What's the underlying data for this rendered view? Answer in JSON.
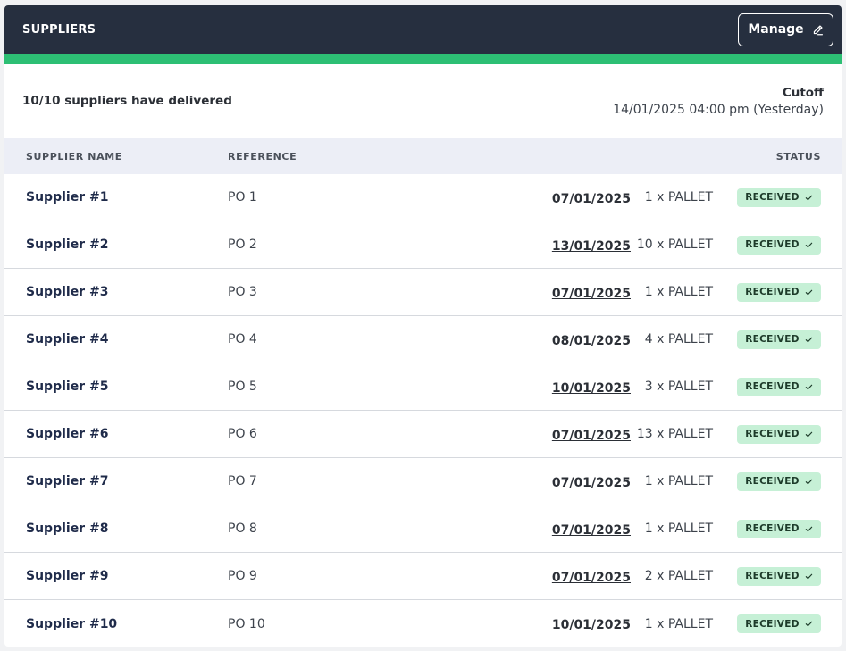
{
  "header": {
    "title": "SUPPLIERS",
    "manage_label": "Manage"
  },
  "summary": {
    "delivered_text": "10/10 suppliers have delivered",
    "cutoff_title": "Cutoff",
    "cutoff_value": "14/01/2025 04:00 pm (Yesterday)"
  },
  "table": {
    "columns": {
      "name": "SUPPLIER NAME",
      "reference": "REFERENCE",
      "status": "STATUS"
    },
    "rows": [
      {
        "name": "Supplier #1",
        "reference": "PO 1",
        "date": "07/01/2025",
        "qty": "1 x PALLET",
        "status": "RECEIVED"
      },
      {
        "name": "Supplier #2",
        "reference": "PO 2",
        "date": "13/01/2025",
        "qty": "10 x PALLET",
        "status": "RECEIVED"
      },
      {
        "name": "Supplier #3",
        "reference": "PO 3",
        "date": "07/01/2025",
        "qty": "1 x PALLET",
        "status": "RECEIVED"
      },
      {
        "name": "Supplier #4",
        "reference": "PO 4",
        "date": "08/01/2025",
        "qty": "4 x PALLET",
        "status": "RECEIVED"
      },
      {
        "name": "Supplier #5",
        "reference": "PO 5",
        "date": "10/01/2025",
        "qty": "3 x PALLET",
        "status": "RECEIVED"
      },
      {
        "name": "Supplier #6",
        "reference": "PO 6",
        "date": "07/01/2025",
        "qty": "13 x PALLET",
        "status": "RECEIVED"
      },
      {
        "name": "Supplier #7",
        "reference": "PO 7",
        "date": "07/01/2025",
        "qty": "1 x PALLET",
        "status": "RECEIVED"
      },
      {
        "name": "Supplier #8",
        "reference": "PO 8",
        "date": "07/01/2025",
        "qty": "1 x PALLET",
        "status": "RECEIVED"
      },
      {
        "name": "Supplier #9",
        "reference": "PO 9",
        "date": "07/01/2025",
        "qty": "2 x PALLET",
        "status": "RECEIVED"
      },
      {
        "name": "Supplier #10",
        "reference": "PO 10",
        "date": "10/01/2025",
        "qty": "1 x PALLET",
        "status": "RECEIVED"
      }
    ]
  },
  "icons": {
    "manage": "pencil-icon",
    "status": "check-icon"
  },
  "colors": {
    "header_bg": "#262f3f",
    "accent": "#2dbf74",
    "table_header_bg": "#eceef6",
    "badge_bg": "#c6f0d6",
    "supplier_text": "#1f2b4a"
  }
}
